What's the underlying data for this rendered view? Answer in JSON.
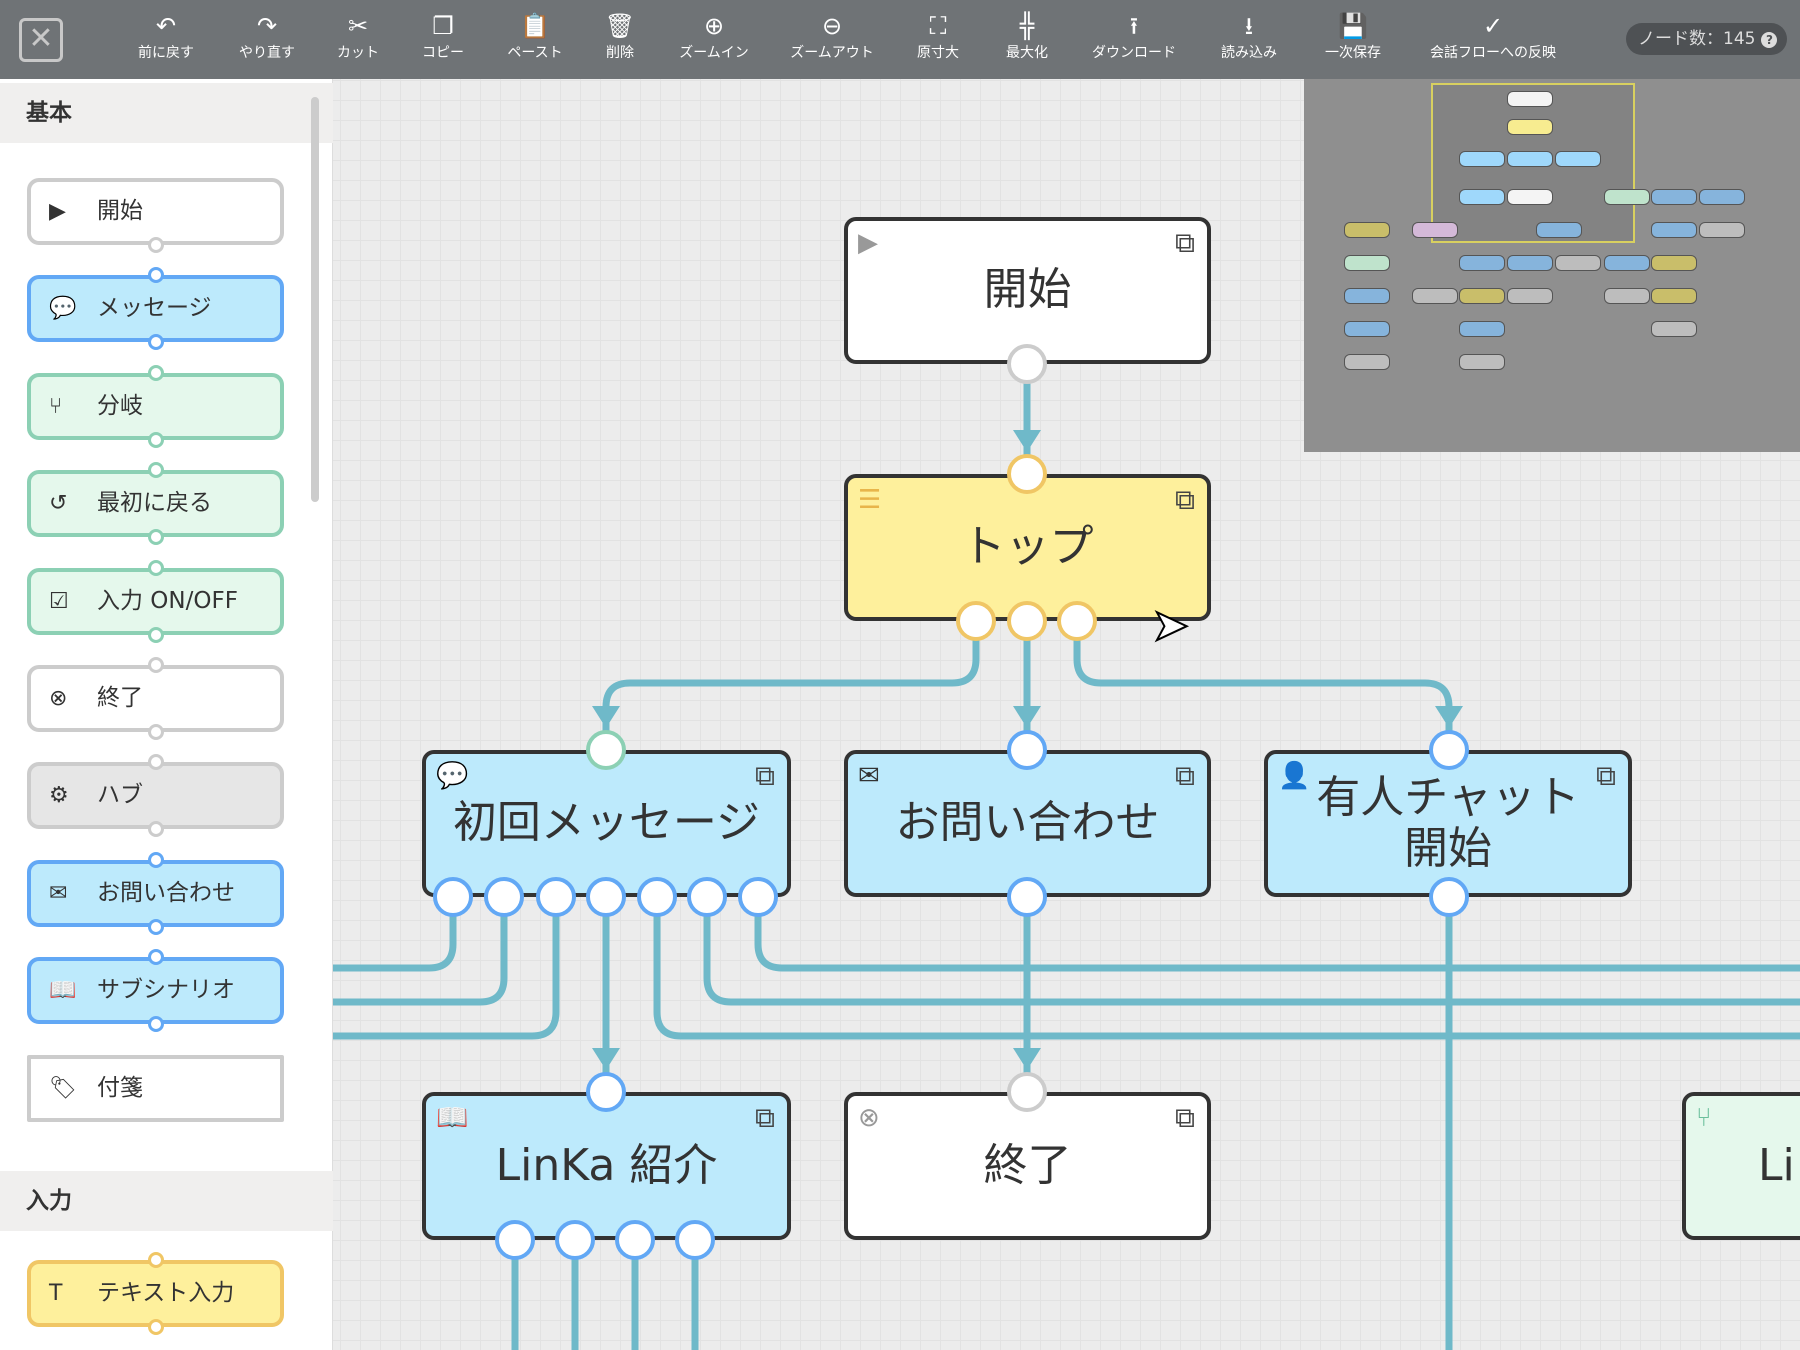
{
  "toolbar": {
    "close": "✕",
    "buttons": [
      {
        "label": "前に戻す",
        "icon": "undo-icon",
        "glyph": "↶"
      },
      {
        "label": "やり直す",
        "icon": "redo-icon",
        "glyph": "↷"
      },
      {
        "label": "カット",
        "icon": "scissors-icon",
        "glyph": "✂"
      },
      {
        "label": "コピー",
        "icon": "copy-icon",
        "glyph": "❐"
      },
      {
        "label": "ペースト",
        "icon": "paste-icon",
        "glyph": "📋"
      },
      {
        "label": "削除",
        "icon": "trash-icon",
        "glyph": "🗑"
      },
      {
        "label": "ズームイン",
        "icon": "zoom-in-icon",
        "glyph": "⊕"
      },
      {
        "label": "ズームアウト",
        "icon": "zoom-out-icon",
        "glyph": "⊖"
      },
      {
        "label": "原寸大",
        "icon": "actual-size-icon",
        "glyph": "⛶"
      },
      {
        "label": "最大化",
        "icon": "maximize-icon",
        "glyph": "╬"
      },
      {
        "label": "ダウンロード",
        "icon": "download-icon",
        "glyph": "⭱"
      },
      {
        "label": "読み込み",
        "icon": "import-icon",
        "glyph": "⭳"
      },
      {
        "label": "一次保存",
        "icon": "save-icon",
        "glyph": "💾"
      },
      {
        "label": "会話フローへの反映",
        "icon": "check-circle-icon",
        "glyph": "✓"
      }
    ],
    "node_count": "ノード数：145",
    "help": "?"
  },
  "sidebar": {
    "sections": [
      "基本",
      "入力"
    ],
    "items": [
      {
        "label": "開始",
        "style": "white",
        "glyph": "▶"
      },
      {
        "label": "メッセージ",
        "style": "blue",
        "glyph": "💬"
      },
      {
        "label": "分岐",
        "style": "green",
        "glyph": "⑂"
      },
      {
        "label": "最初に戻る",
        "style": "green",
        "glyph": "↺"
      },
      {
        "label": "入力 ON/OFF",
        "style": "green",
        "glyph": "☑"
      },
      {
        "label": "終了",
        "style": "white",
        "glyph": "⊗"
      },
      {
        "label": "ハブ",
        "style": "gray",
        "glyph": "⚙"
      },
      {
        "label": "お問い合わせ",
        "style": "blue",
        "glyph": "✉"
      },
      {
        "label": "サブシナリオ",
        "style": "blue",
        "glyph": "📖"
      },
      {
        "label": "付箋",
        "style": "white",
        "glyph": "🏷"
      }
    ],
    "input_items": [
      {
        "label": "テキスト入力",
        "style": "yellow",
        "glyph": "T"
      }
    ]
  },
  "canvas": {
    "nodes": [
      {
        "label": "開始",
        "glyph": "▶"
      },
      {
        "label": "トップ",
        "glyph": "☰"
      },
      {
        "label": "初回メッセージ",
        "glyph": "💬"
      },
      {
        "label": "お問い合わせ",
        "glyph": "✉"
      },
      {
        "label": "有人チャット\n開始",
        "glyph": "👤"
      },
      {
        "label": "LinKa 紹介",
        "glyph": "📖"
      },
      {
        "label": "終了",
        "glyph": "⊗"
      },
      {
        "label": "Li",
        "glyph": "⑂"
      }
    ],
    "ext": "⧉",
    "wire_color": "#6fb9c9"
  }
}
